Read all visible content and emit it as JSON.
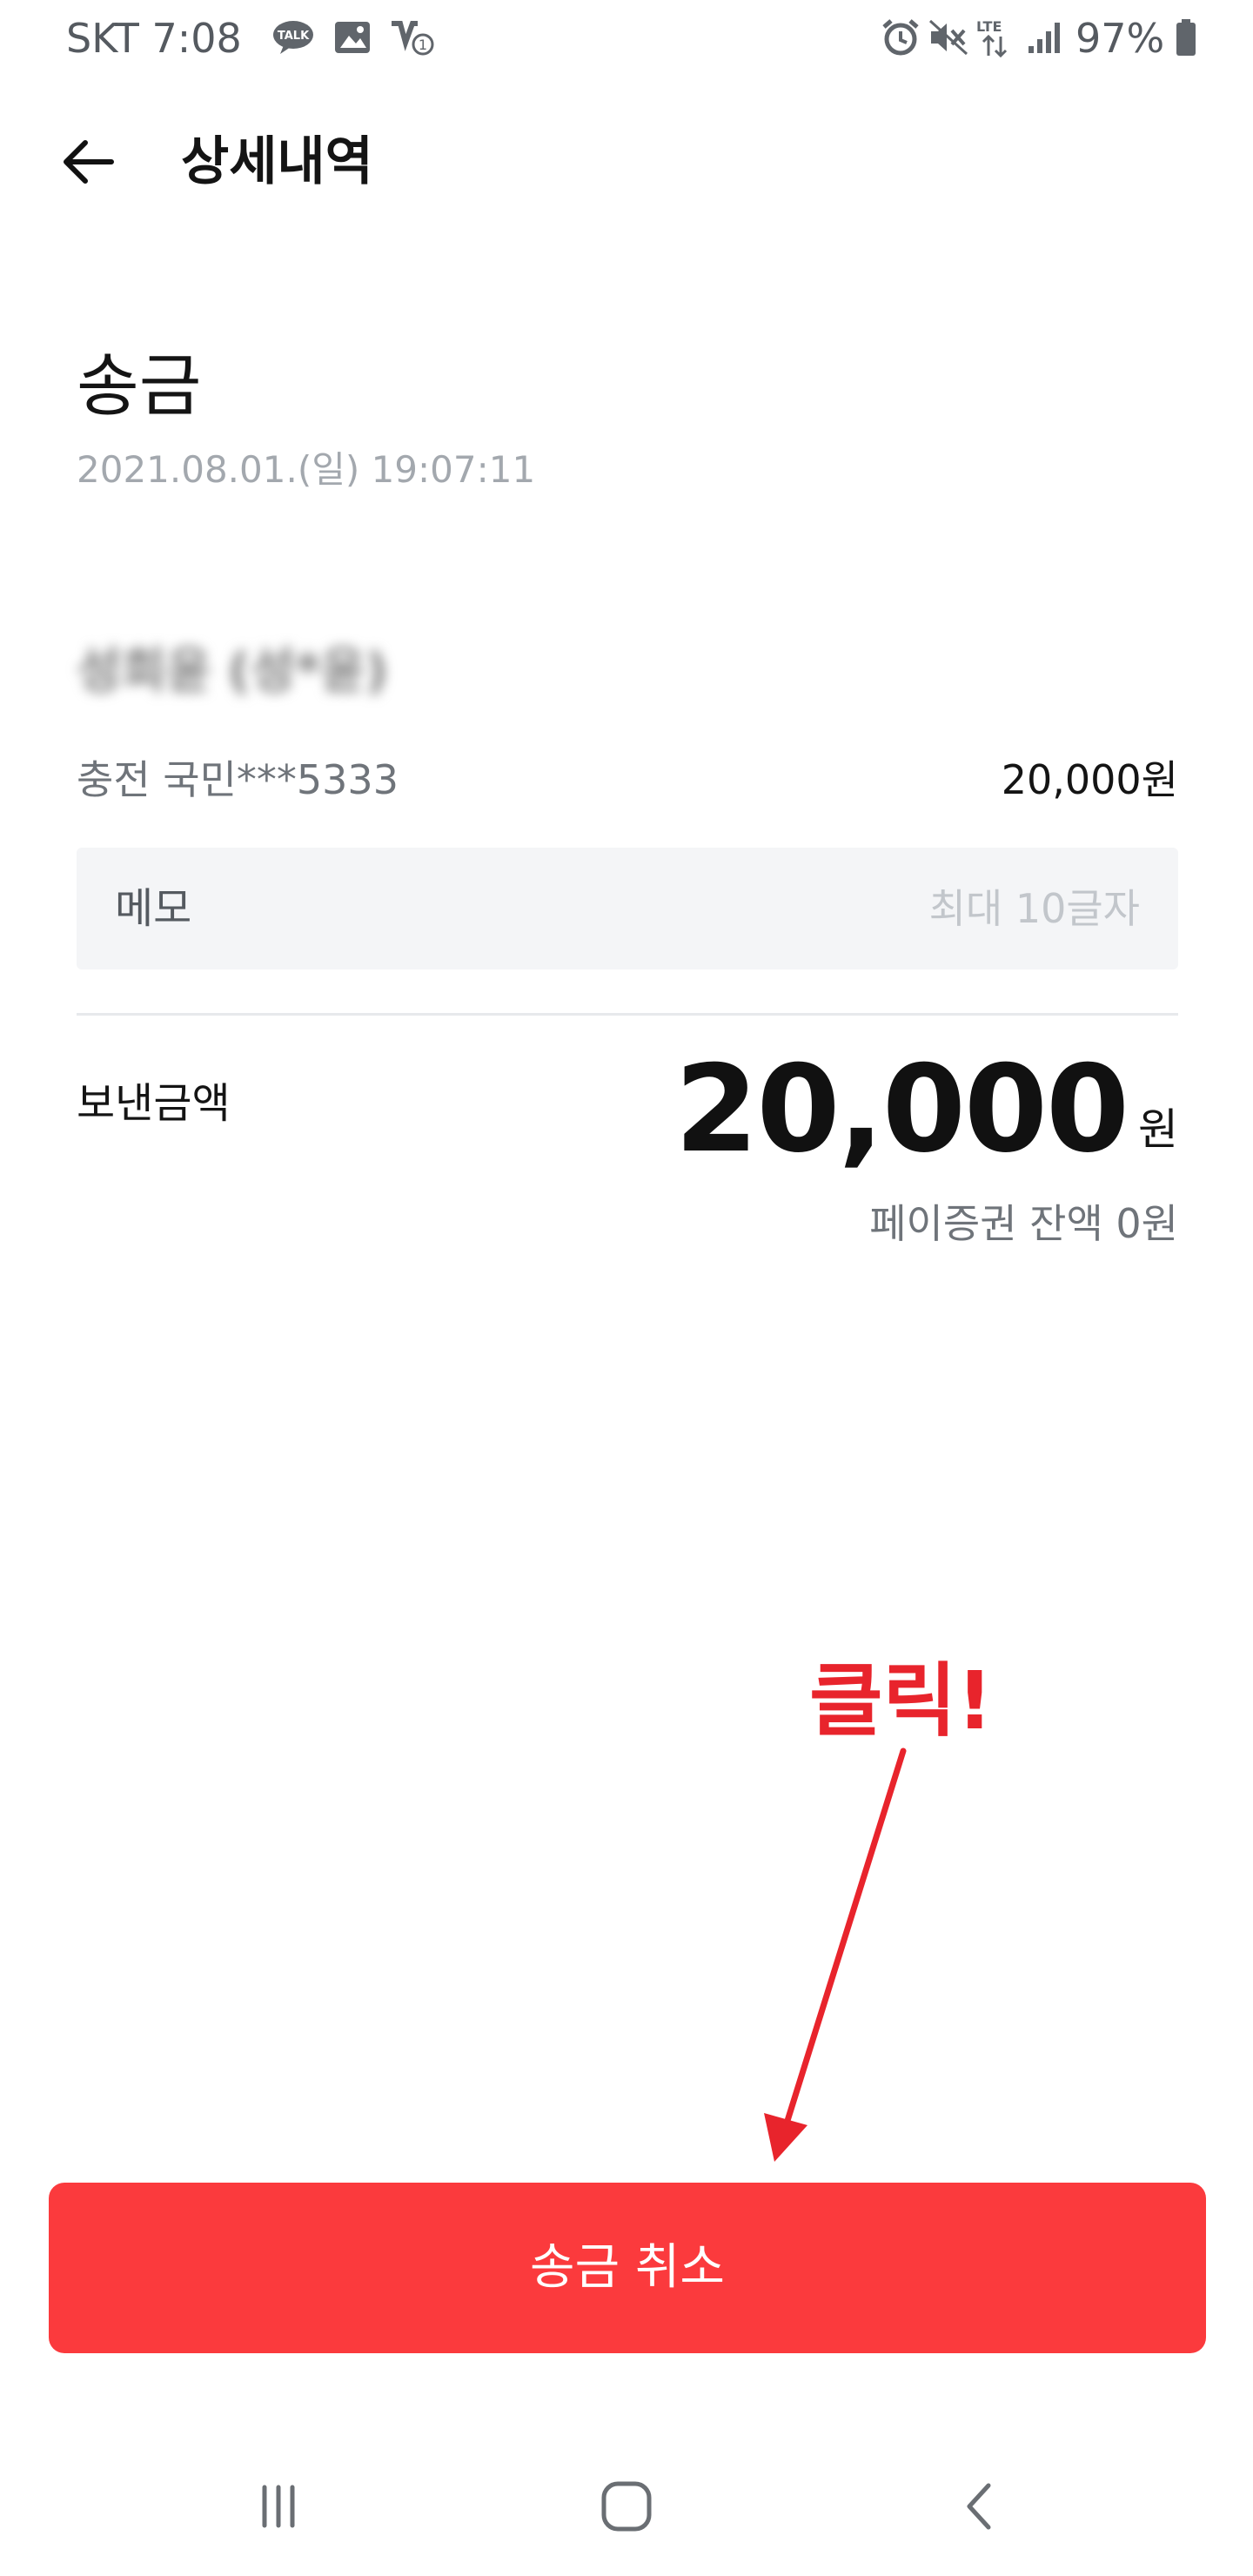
{
  "status_bar": {
    "carrier_time": "SKT 7:08",
    "battery_percent": "97%",
    "icons": [
      "kakaotalk-icon",
      "gallery-icon",
      "notification-icon",
      "alarm-icon",
      "mute-icon",
      "lte-icon",
      "signal-icon",
      "battery-icon"
    ]
  },
  "header": {
    "title": "상세내역"
  },
  "transaction": {
    "type": "송금",
    "datetime": "2021.08.01.(일) 19:07:11",
    "recipient": "성희윤 (성*윤)",
    "charge_label": "충전 국민***5333",
    "charge_amount": "20,000원"
  },
  "memo": {
    "label": "메모",
    "placeholder": "최대 10글자"
  },
  "sent": {
    "label": "보낸금액",
    "amount": "20,000",
    "unit": "원",
    "balance": "페이증권 잔액 0원"
  },
  "annotation": {
    "text": "클릭!",
    "color": "#e8242c"
  },
  "cancel_button": {
    "label": "송금 취소",
    "color": "#fb3a3d"
  },
  "nav_bar": {
    "icons": [
      "recent-apps-icon",
      "home-icon",
      "back-nav-icon"
    ]
  }
}
